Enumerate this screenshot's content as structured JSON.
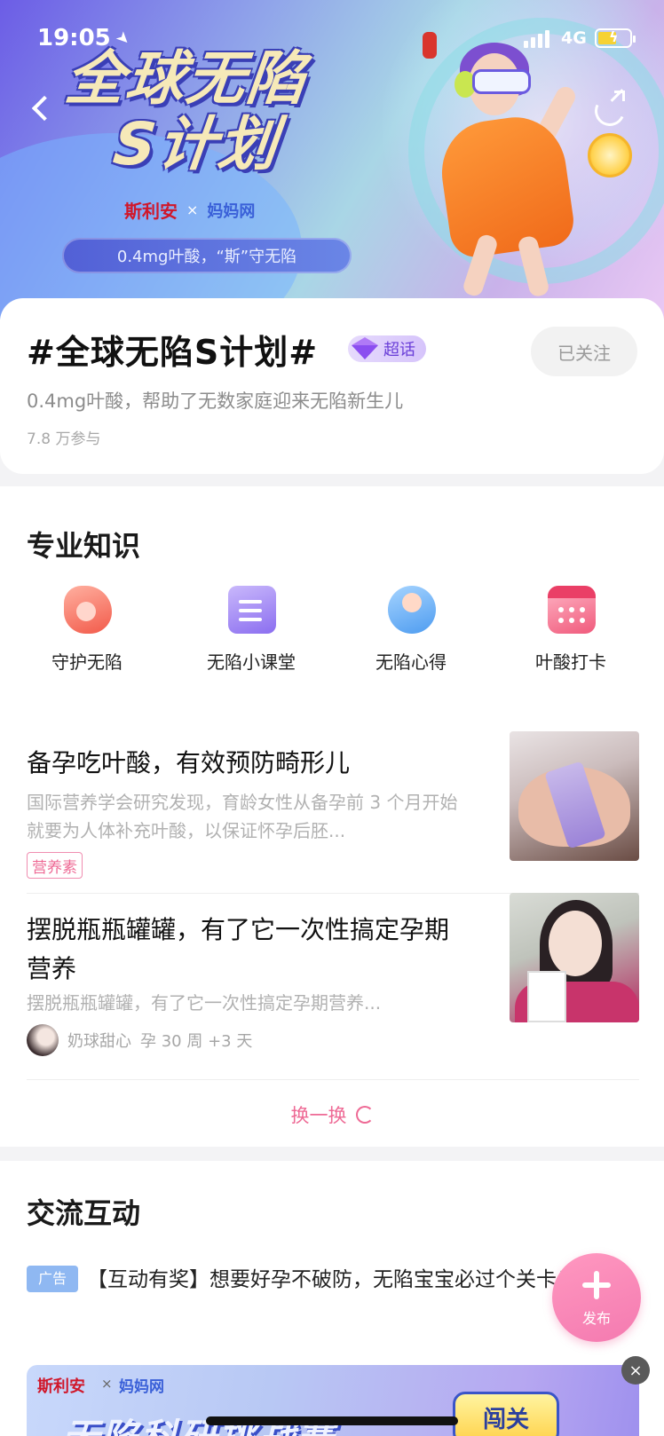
{
  "status_bar": {
    "time": "19:05",
    "network": "4G"
  },
  "banner": {
    "title_line1": "全球无陷",
    "title_line2": "S计划",
    "brand_left": "斯利安",
    "brand_x": "×",
    "brand_right": "妈妈网",
    "slogan": "0.4mg叶酸，“斯”守无陷"
  },
  "topic": {
    "title": "#全球无陷S计划#",
    "badge": "超话",
    "follow_label": "已关注",
    "description": "0.4mg叶酸，帮助了无数家庭迎来无陷新生儿",
    "participants": "7.8 万参与"
  },
  "knowledge": {
    "section_title": "专业知识",
    "categories": [
      {
        "label": "守护无陷",
        "icon": "pregnancy-icon"
      },
      {
        "label": "无陷小课堂",
        "icon": "clipboard-icon"
      },
      {
        "label": "无陷心得",
        "icon": "mother-baby-icon"
      },
      {
        "label": "叶酸打卡",
        "icon": "calendar-icon"
      }
    ],
    "articles": [
      {
        "title": "备孕吃叶酸，有效预防畸形儿",
        "desc": "国际营养学会研究发现，育龄女性从备孕前 3 个月开始就要为人体补充叶酸，以保证怀孕后胚...",
        "tag": "营养素"
      },
      {
        "title": "摆脱瓶瓶罐罐，有了它一次性搞定孕期营养",
        "desc": "摆脱瓶瓶罐罐，有了它一次性搞定孕期营养...",
        "author": "奶球甜心",
        "pregnancy_week": "孕 30 周 +3 天"
      }
    ],
    "refresh_label": "换一换"
  },
  "interaction": {
    "section_title": "交流互动",
    "ad_tag": "广告",
    "ad_text": "【互动有奖】想要好孕不破防，无陷宝宝必过个关卡！",
    "ad_banner_brand_left": "斯利安",
    "ad_banner_x": "×",
    "ad_banner_brand_right": "妈妈网",
    "ad_banner_text": "无陷科研挑战赛",
    "ad_banner_button": "闯关",
    "ad_close": "×"
  },
  "fab": {
    "label": "发布"
  }
}
